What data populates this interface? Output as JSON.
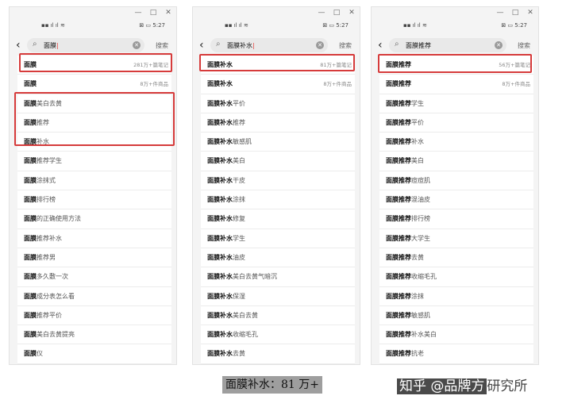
{
  "panels": [
    {
      "window_controls": [
        "—",
        "□",
        "✕"
      ],
      "status": {
        "signal": "▪▪ ıl ıl ≋",
        "right": "⊠ ▭ 5:27"
      },
      "query": "面膜",
      "search_button": "搜索",
      "rows": [
        {
          "bold": "面膜",
          "rest": "",
          "meta": "281万+篇笔记"
        },
        {
          "bold": "面膜",
          "rest": "",
          "meta": "8万+件商品"
        },
        {
          "bold": "面膜",
          "rest": "美白去黄",
          "meta": ""
        },
        {
          "bold": "面膜",
          "rest": "推荐",
          "meta": ""
        },
        {
          "bold": "面膜",
          "rest": "补水",
          "meta": ""
        },
        {
          "bold": "面膜",
          "rest": "推荐学生",
          "meta": ""
        },
        {
          "bold": "面膜",
          "rest": "涂抹式",
          "meta": ""
        },
        {
          "bold": "面膜",
          "rest": "排行榜",
          "meta": ""
        },
        {
          "bold": "面膜",
          "rest": "的正确使用方法",
          "meta": ""
        },
        {
          "bold": "面膜",
          "rest": "推荐补水",
          "meta": ""
        },
        {
          "bold": "面膜",
          "rest": "推荐男",
          "meta": ""
        },
        {
          "bold": "面膜",
          "rest": "多久敷一次",
          "meta": ""
        },
        {
          "bold": "面膜",
          "rest": "成分表怎么看",
          "meta": ""
        },
        {
          "bold": "面膜",
          "rest": "推荐平价",
          "meta": ""
        },
        {
          "bold": "面膜",
          "rest": "美白去黄提亮",
          "meta": ""
        },
        {
          "bold": "面膜",
          "rest": "仪",
          "meta": ""
        }
      ]
    },
    {
      "window_controls": [
        "—",
        "□",
        "✕"
      ],
      "status": {
        "signal": "▪▪ ıl ıl ≋",
        "right": "⊠ ▭ 5:27"
      },
      "query": "面膜补水",
      "search_button": "搜索",
      "rows": [
        {
          "bold": "面膜补水",
          "rest": "",
          "meta": "81万+篇笔记"
        },
        {
          "bold": "面膜补水",
          "rest": "",
          "meta": "8万+件商品"
        },
        {
          "bold": "面膜补水",
          "rest": "平价",
          "meta": ""
        },
        {
          "bold": "面膜补水",
          "rest": "推荐",
          "meta": ""
        },
        {
          "bold": "面膜补水",
          "rest": "敏感肌",
          "meta": ""
        },
        {
          "bold": "面膜补水",
          "rest": "美白",
          "meta": ""
        },
        {
          "bold": "面膜补水",
          "rest": "干皮",
          "meta": ""
        },
        {
          "bold": "面膜补水",
          "rest": "涂抹",
          "meta": ""
        },
        {
          "bold": "面膜补水",
          "rest": "修复",
          "meta": ""
        },
        {
          "bold": "面膜补水",
          "rest": "学生",
          "meta": ""
        },
        {
          "bold": "面膜补水",
          "rest": "油皮",
          "meta": ""
        },
        {
          "bold": "面膜补水",
          "rest": "美白去黄气暗沉",
          "meta": ""
        },
        {
          "bold": "面膜补水",
          "rest": "保湿",
          "meta": ""
        },
        {
          "bold": "面膜补水",
          "rest": "美白去黄",
          "meta": ""
        },
        {
          "bold": "面膜补水",
          "rest": "收缩毛孔",
          "meta": ""
        },
        {
          "bold": "面膜补水",
          "rest": "去黄",
          "meta": ""
        }
      ]
    },
    {
      "window_controls": [
        "—",
        "□",
        "✕"
      ],
      "status": {
        "signal": "▪▪ ıl ıl ≋",
        "right": "⊠ ▭ 5:27"
      },
      "query": "面膜推荐",
      "search_button": "搜索",
      "rows": [
        {
          "bold": "面膜推荐",
          "rest": "",
          "meta": "56万+篇笔记"
        },
        {
          "bold": "面膜推荐",
          "rest": "",
          "meta": "8万+件商品"
        },
        {
          "bold": "面膜推荐",
          "rest": "学生",
          "meta": ""
        },
        {
          "bold": "面膜推荐",
          "rest": "平价",
          "meta": ""
        },
        {
          "bold": "面膜推荐",
          "rest": "补水",
          "meta": ""
        },
        {
          "bold": "面膜推荐",
          "rest": "美白",
          "meta": ""
        },
        {
          "bold": "面膜推荐",
          "rest": "痘痘肌",
          "meta": ""
        },
        {
          "bold": "面膜推荐",
          "rest": "混油皮",
          "meta": ""
        },
        {
          "bold": "面膜推荐",
          "rest": "排行榜",
          "meta": ""
        },
        {
          "bold": "面膜推荐",
          "rest": "大学生",
          "meta": ""
        },
        {
          "bold": "面膜推荐",
          "rest": "去黄",
          "meta": ""
        },
        {
          "bold": "面膜推荐",
          "rest": "收缩毛孔",
          "meta": ""
        },
        {
          "bold": "面膜推荐",
          "rest": "涂抹",
          "meta": ""
        },
        {
          "bold": "面膜推荐",
          "rest": "敏感肌",
          "meta": ""
        },
        {
          "bold": "面膜推荐",
          "rest": "补水美白",
          "meta": ""
        },
        {
          "bold": "面膜推荐",
          "rest": "抗老",
          "meta": ""
        }
      ]
    }
  ],
  "captions": {
    "left": "面膜补水：81 万+",
    "right_prefix": "知乎 @品牌方",
    "right_suffix": "研究所"
  },
  "colors": {
    "highlight": "#d63b3b"
  }
}
